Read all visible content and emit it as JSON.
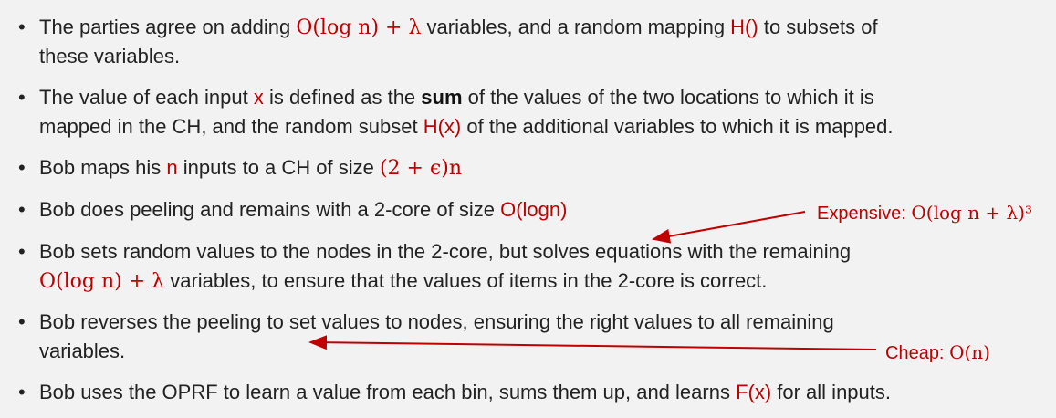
{
  "bullets": [
    {
      "lines": [
        [
          "The parties agree on adding ",
          {
            "m": "O(log n) + λ"
          },
          " variables, and a random mapping ",
          {
            "r": "H()"
          },
          " to subsets of"
        ],
        [
          "these variables."
        ]
      ]
    },
    {
      "lines": [
        [
          "The value of each input ",
          {
            "r": "x"
          },
          " is defined as the ",
          {
            "b": "sum"
          },
          " of the values of the two locations to which it is"
        ],
        [
          "mapped in the CH, and the random subset ",
          {
            "r": "H(x)"
          },
          " of the additional variables to which it is mapped."
        ]
      ]
    },
    {
      "lines": [
        [
          "Bob maps his ",
          {
            "r": "n"
          },
          " inputs to a CH of size ",
          {
            "m": "(2 + ϵ)n"
          }
        ]
      ]
    },
    {
      "lines": [
        [
          "Bob does peeling and remains with a 2-core of size ",
          {
            "r": "O(logn)"
          }
        ]
      ]
    },
    {
      "lines": [
        [
          "Bob sets random values to the nodes in the 2-core, but solves equations with the remaining"
        ],
        [
          {
            "m": "O(log n) + λ"
          },
          " variables, to ensure that the values of items in the 2-core is correct."
        ]
      ]
    },
    {
      "lines": [
        [
          "Bob reverses the peeling to set values to nodes, ensuring the right values to all remaining"
        ],
        [
          "variables."
        ]
      ]
    },
    {
      "lines": [
        [
          "Bob uses the OPRF to learn a value from each bin, sums them up, and learns ",
          {
            "r": "F(x)"
          },
          " for all inputs."
        ]
      ]
    }
  ],
  "bullet_glyph": "•",
  "annotations": {
    "expensive_label": "Expensive: ",
    "expensive_math": "O(log n + λ)³",
    "cheap_label": "Cheap: ",
    "cheap_math": "O(n)"
  },
  "colors": {
    "accent": "#c00000",
    "text": "#222222",
    "background": "#f2f2f2"
  }
}
